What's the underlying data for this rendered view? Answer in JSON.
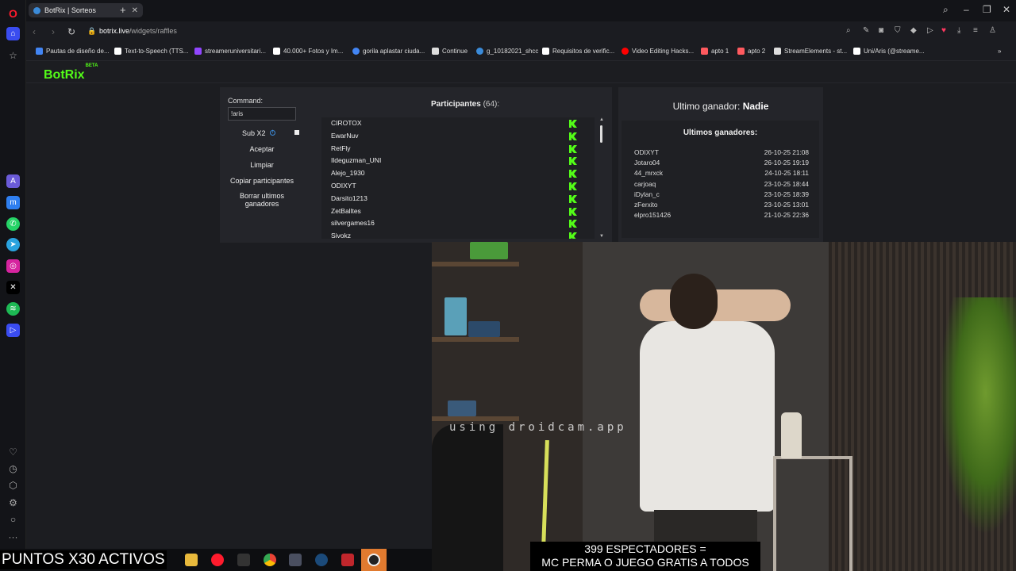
{
  "browser": {
    "tab_title": "BotRix | Sorteos",
    "url_host": "botrix.live",
    "url_path": "/widgets/raffles"
  },
  "bookmarks": [
    {
      "label": "Pautas de diseño de...",
      "color": "#4285f4"
    },
    {
      "label": "Text-to-Speech (TTS...",
      "color": "#ffffff"
    },
    {
      "label": "streameruniversitari...",
      "color": "#9146ff"
    },
    {
      "label": "40.000+ Fotos y Im...",
      "color": "#ffffff"
    },
    {
      "label": "gorila aplastar ciuda...",
      "color": "#4285f4"
    },
    {
      "label": "Continue",
      "color": "#dddddd"
    },
    {
      "label": "g_10182021_shcc",
      "color": "#3b8bd9"
    },
    {
      "label": "Requisitos de verific...",
      "color": "#ffffff"
    },
    {
      "label": "Video Editing Hacks...",
      "color": "#ff0000"
    },
    {
      "label": "apto 1",
      "color": "#ff5a5f"
    },
    {
      "label": "apto 2",
      "color": "#ff5a5f"
    },
    {
      "label": "StreamElements - st...",
      "color": "#dddddd"
    },
    {
      "label": "Uni/Aris (@streame...",
      "color": "#ffffff"
    }
  ],
  "app": {
    "logo": "BotRix",
    "logo_badge": "BETA",
    "accent_color": "#53fc18"
  },
  "raffle": {
    "command_label": "Command:",
    "command_value": "!aris",
    "sub_label": "Sub X2",
    "buttons": {
      "accept": "Aceptar",
      "clear": "Limpiar",
      "copy": "Copiar participantes",
      "delete_1": "Borrar ultimos",
      "delete_2": "ganadores"
    },
    "participants_title": "Participantes",
    "participants_count": "(64):",
    "participants": [
      "CIROTOX",
      "EwarNuv",
      "RetFly",
      "Ildeguzman_UNI",
      "Alejo_1930",
      "ODIXYT",
      "Darsito1213",
      "ZetBalltes",
      "silvergames16",
      "Sivokz"
    ]
  },
  "winners": {
    "last_label": "Ultimo ganador:",
    "last_value": "Nadie",
    "title": "Ultimos ganadores:",
    "list": [
      {
        "name": "ODIXYT",
        "date": "26-10-25 21:08"
      },
      {
        "name": "Jotaro04",
        "date": "26-10-25 19:19"
      },
      {
        "name": "44_mrxck",
        "date": "24-10-25 18:11"
      },
      {
        "name": "carjoaq",
        "date": "23-10-25 18:44"
      },
      {
        "name": "iDylan_c",
        "date": "23-10-25 18:39"
      },
      {
        "name": "zFerxito",
        "date": "23-10-25 13:01"
      },
      {
        "name": "elpro151426",
        "date": "21-10-25 22:36"
      }
    ]
  },
  "overlay": {
    "watermark": "using droidcam.app",
    "caption_1": "399 ESPECTADORES =",
    "caption_2": "MC PERMA O JUEGO GRATIS A TODOS",
    "points": "PUNTOS X30 ACTIVOS"
  }
}
